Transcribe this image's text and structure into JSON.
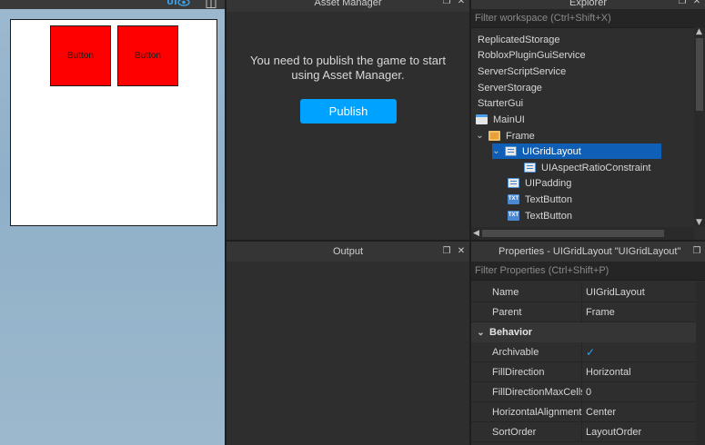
{
  "viewport": {
    "mode_label": "UI",
    "buttons": [
      "Button",
      "Button"
    ]
  },
  "asset_manager": {
    "title": "Asset Manager",
    "message": "You need to publish the game to start using Asset Manager.",
    "publish_label": "Publish"
  },
  "explorer": {
    "title": "Explorer",
    "filter_placeholder": "Filter workspace (Ctrl+Shift+X)",
    "items": [
      "ReplicatedStorage",
      "RobloxPluginGuiService",
      "ServerScriptService",
      "ServerStorage",
      "StarterGui",
      "MainUI",
      "Frame",
      "UIGridLayout",
      "UIAspectRatioConstraint",
      "UIPadding",
      "TextButton",
      "TextButton"
    ],
    "txt_icon_label": "TXT"
  },
  "output": {
    "title": "Output"
  },
  "properties": {
    "title": "Properties - UIGridLayout \"UIGridLayout\"",
    "filter_placeholder": "Filter Properties (Ctrl+Shift+P)",
    "rows": [
      {
        "name": "Name",
        "value": "UIGridLayout"
      },
      {
        "name": "Parent",
        "value": "Frame"
      }
    ],
    "category": "Behavior",
    "behavior_rows": [
      {
        "name": "Archivable",
        "value": "✓"
      },
      {
        "name": "FillDirection",
        "value": "Horizontal"
      },
      {
        "name": "FillDirectionMaxCells",
        "value": "0"
      },
      {
        "name": "HorizontalAlignment",
        "value": "Center"
      },
      {
        "name": "SortOrder",
        "value": "LayoutOrder"
      }
    ]
  },
  "colors": {
    "accent": "#00a2ff",
    "selection": "#0e5fb5",
    "button_red": "#ff0000"
  }
}
